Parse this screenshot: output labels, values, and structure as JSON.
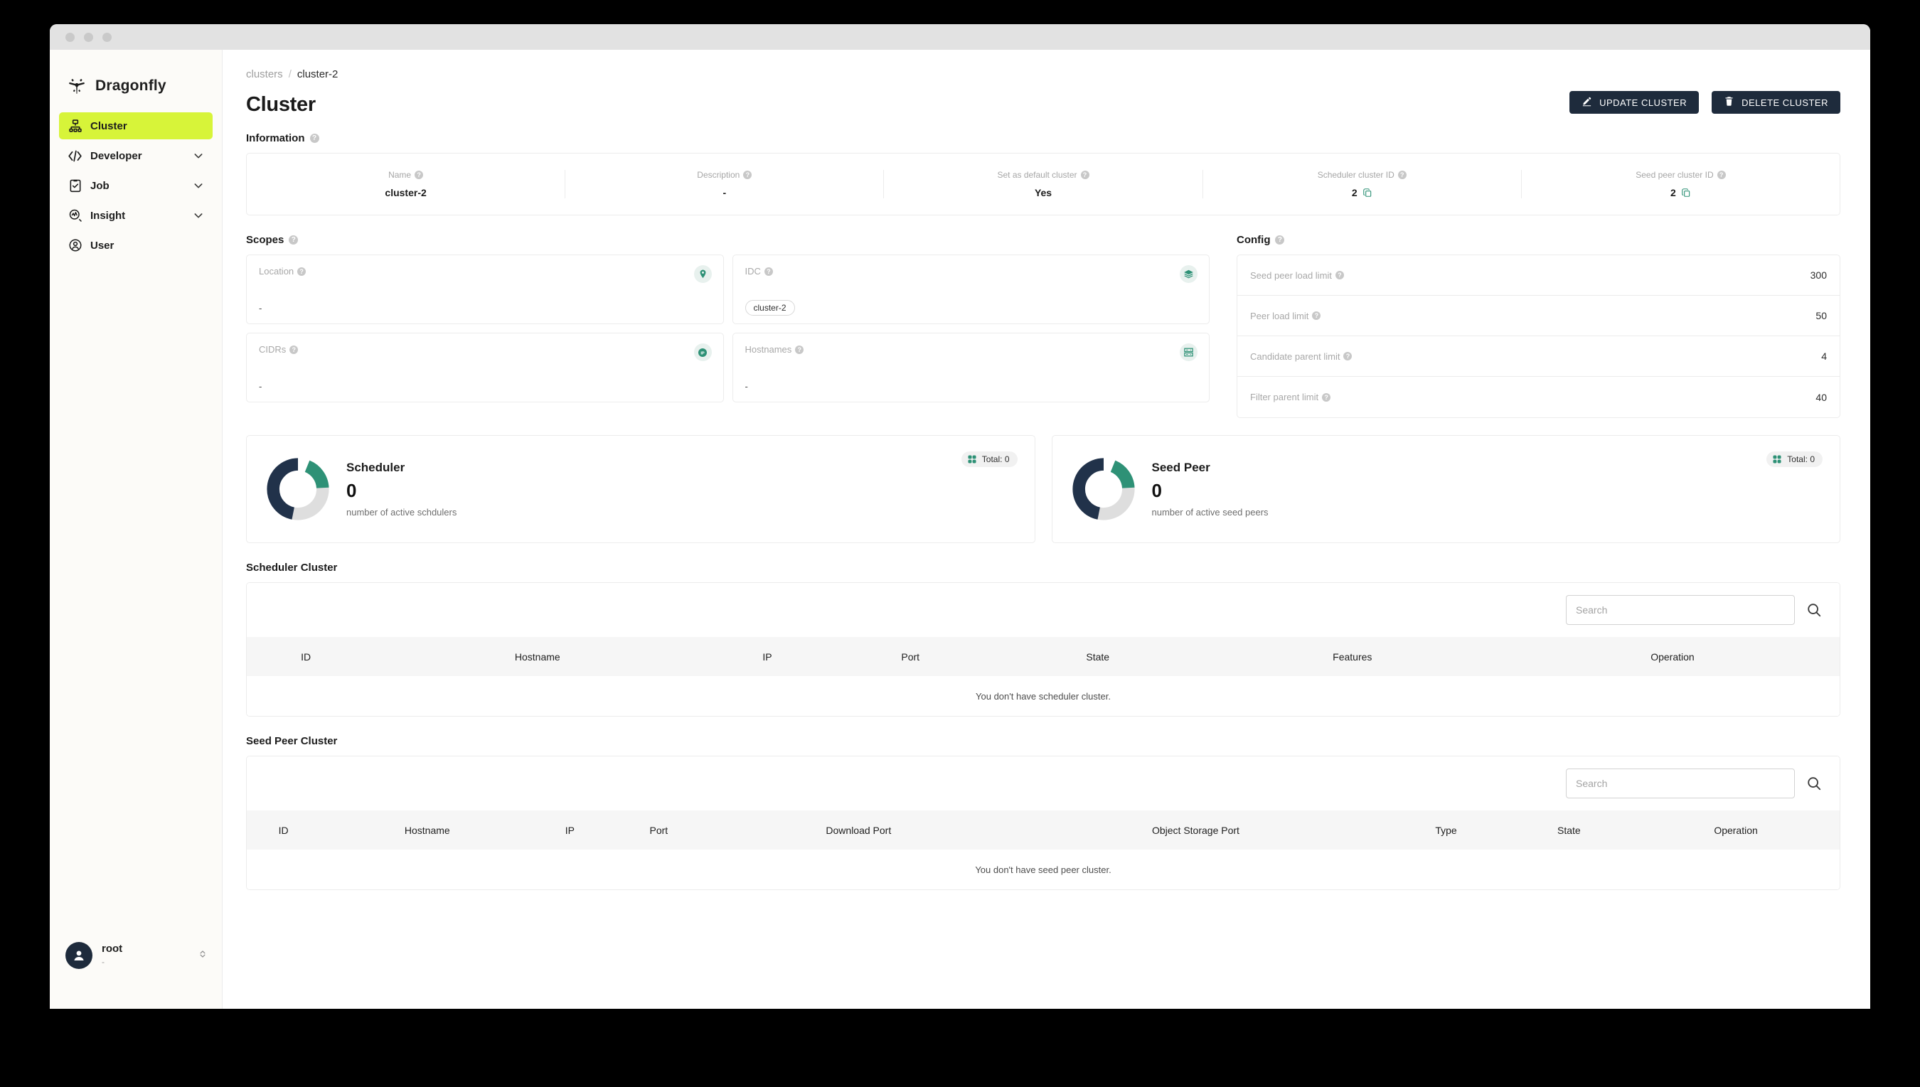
{
  "window": {
    "dots": 3
  },
  "sidebar": {
    "brand": "Dragonfly",
    "items": [
      {
        "label": "Cluster",
        "icon": "cluster-icon",
        "active": true,
        "chevron": false
      },
      {
        "label": "Developer",
        "icon": "code-icon",
        "active": false,
        "chevron": true
      },
      {
        "label": "Job",
        "icon": "clipboard-icon",
        "active": false,
        "chevron": true
      },
      {
        "label": "Insight",
        "icon": "insight-icon",
        "active": false,
        "chevron": true
      },
      {
        "label": "User",
        "icon": "user-icon",
        "active": false,
        "chevron": false
      }
    ],
    "user": {
      "name": "root",
      "sub": "-"
    },
    "accent": "#d7f439"
  },
  "breadcrumb": {
    "root": "clusters",
    "sep": "/",
    "current": "cluster-2"
  },
  "header": {
    "title": "Cluster",
    "update_label": "UPDATE CLUSTER",
    "delete_label": "DELETE CLUSTER",
    "button_bg": "#1e2b3c"
  },
  "information": {
    "section_label": "Information",
    "cells": [
      {
        "label": "Name",
        "value": "cluster-2",
        "copy": false
      },
      {
        "label": "Description",
        "value": "-",
        "copy": false
      },
      {
        "label": "Set as default cluster",
        "value": "Yes",
        "copy": false
      },
      {
        "label": "Scheduler cluster ID",
        "value": "2",
        "copy": true
      },
      {
        "label": "Seed peer cluster ID",
        "value": "2",
        "copy": true
      }
    ]
  },
  "scopes": {
    "section_label": "Scopes",
    "cards": [
      {
        "label": "Location",
        "icon": "location-pin-icon",
        "value": "-",
        "chip": null
      },
      {
        "label": "IDC",
        "icon": "layers-icon",
        "value": null,
        "chip": "cluster-2"
      },
      {
        "label": "CIDRs",
        "icon": "ip-shield-icon",
        "value": "-",
        "chip": null
      },
      {
        "label": "Hostnames",
        "icon": "server-rack-icon",
        "value": "-",
        "chip": null
      }
    ]
  },
  "config": {
    "section_label": "Config",
    "rows": [
      {
        "label": "Seed peer load limit",
        "value": "300"
      },
      {
        "label": "Peer load limit",
        "value": "50"
      },
      {
        "label": "Candidate parent limit",
        "value": "4"
      },
      {
        "label": "Filter parent limit",
        "value": "40"
      }
    ]
  },
  "stats": [
    {
      "name": "Scheduler",
      "count": "0",
      "description": "number of active schdulers",
      "total_label": "Total: 0",
      "donut": {
        "green": 20,
        "gray": 33,
        "navy": 47
      }
    },
    {
      "name": "Seed Peer",
      "count": "0",
      "description": "number of active seed peers",
      "total_label": "Total: 0",
      "donut": {
        "green": 20,
        "gray": 33,
        "navy": 47
      }
    }
  ],
  "colors": {
    "green": "#2e9176",
    "navy": "#21324a",
    "light_gray": "#dedede",
    "accent": "#d7f439"
  },
  "scheduler_table": {
    "section_label": "Scheduler Cluster",
    "search_placeholder": "Search",
    "search_value": "",
    "columns": [
      "ID",
      "Hostname",
      "IP",
      "Port",
      "State",
      "Features",
      "Operation"
    ],
    "empty_text": "You don't have scheduler cluster.",
    "rows": []
  },
  "seed_peer_table": {
    "section_label": "Seed Peer Cluster",
    "search_placeholder": "Search",
    "search_value": "",
    "columns": [
      "ID",
      "Hostname",
      "IP",
      "Port",
      "Download Port",
      "Object Storage Port",
      "Type",
      "State",
      "Operation"
    ],
    "empty_text": "You don't have seed peer cluster.",
    "rows": []
  }
}
